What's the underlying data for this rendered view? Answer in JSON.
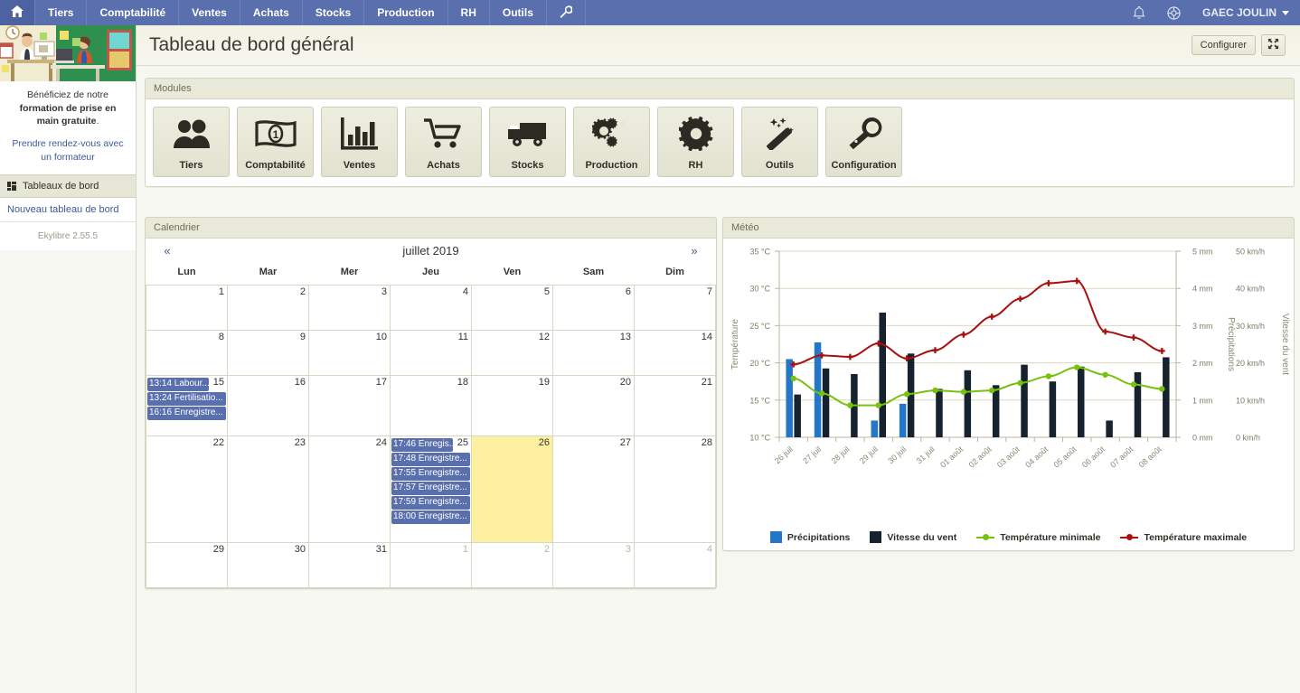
{
  "topnav": {
    "home_icon": "home-icon",
    "items": [
      {
        "label": "Tiers"
      },
      {
        "label": "Comptabilité"
      },
      {
        "label": "Ventes"
      },
      {
        "label": "Achats"
      },
      {
        "label": "Stocks"
      },
      {
        "label": "Production"
      },
      {
        "label": "RH"
      },
      {
        "label": "Outils"
      }
    ],
    "wrench_icon": "wrench-icon",
    "bell_icon": "bell-icon",
    "help_icon": "help-icon",
    "user": "GAEC JOULIN"
  },
  "sidebar": {
    "promo_text_plain_1": "Bénéficiez de notre ",
    "promo_text_bold": "formation de prise en main gratuite",
    "promo_text_plain_2": ".",
    "promo_link": "Prendre rendez-vous avec un formateur",
    "section_label": "Tableaux de bord",
    "new_dashboard_link": "Nouveau tableau de bord",
    "version": "Ekylibre 2.55.5"
  },
  "header": {
    "title": "Tableau de bord général",
    "configure_button": "Configurer",
    "fullscreen_icon": "fullscreen-icon"
  },
  "modules": {
    "panel_title": "Modules",
    "tiles": [
      {
        "label": "Tiers",
        "icon": "people-icon"
      },
      {
        "label": "Comptabilité",
        "icon": "banknote-icon"
      },
      {
        "label": "Ventes",
        "icon": "bar-chart-icon"
      },
      {
        "label": "Achats",
        "icon": "shopping-cart-icon"
      },
      {
        "label": "Stocks",
        "icon": "truck-icon"
      },
      {
        "label": "Production",
        "icon": "gears-icon"
      },
      {
        "label": "RH",
        "icon": "gear-icon"
      },
      {
        "label": "Outils",
        "icon": "magic-wand-icon"
      },
      {
        "label": "Configuration",
        "icon": "wrench-icon"
      }
    ]
  },
  "calendar": {
    "panel_title": "Calendrier",
    "prev_label": "«",
    "next_label": "»",
    "month_label": "juillet 2019",
    "weekdays": [
      "Lun",
      "Mar",
      "Mer",
      "Jeu",
      "Ven",
      "Sam",
      "Dim"
    ],
    "weeks": [
      [
        {
          "day": "1",
          "other": false,
          "today": false,
          "events": []
        },
        {
          "day": "2",
          "other": false,
          "today": false,
          "events": []
        },
        {
          "day": "3",
          "other": false,
          "today": false,
          "events": []
        },
        {
          "day": "4",
          "other": false,
          "today": false,
          "events": []
        },
        {
          "day": "5",
          "other": false,
          "today": false,
          "events": []
        },
        {
          "day": "6",
          "other": false,
          "today": false,
          "events": []
        },
        {
          "day": "7",
          "other": false,
          "today": false,
          "events": []
        }
      ],
      [
        {
          "day": "8",
          "other": false,
          "today": false,
          "events": []
        },
        {
          "day": "9",
          "other": false,
          "today": false,
          "events": []
        },
        {
          "day": "10",
          "other": false,
          "today": false,
          "events": []
        },
        {
          "day": "11",
          "other": false,
          "today": false,
          "events": []
        },
        {
          "day": "12",
          "other": false,
          "today": false,
          "events": []
        },
        {
          "day": "13",
          "other": false,
          "today": false,
          "events": []
        },
        {
          "day": "14",
          "other": false,
          "today": false,
          "events": []
        }
      ],
      [
        {
          "day": "15",
          "other": false,
          "today": false,
          "events": [
            "13:14 Labour...",
            "13:24 Fertilisatio...",
            "16:16 Enregistre..."
          ]
        },
        {
          "day": "16",
          "other": false,
          "today": false,
          "events": []
        },
        {
          "day": "17",
          "other": false,
          "today": false,
          "events": []
        },
        {
          "day": "18",
          "other": false,
          "today": false,
          "events": []
        },
        {
          "day": "19",
          "other": false,
          "today": false,
          "events": []
        },
        {
          "day": "20",
          "other": false,
          "today": false,
          "events": []
        },
        {
          "day": "21",
          "other": false,
          "today": false,
          "events": []
        }
      ],
      [
        {
          "day": "22",
          "other": false,
          "today": false,
          "events": []
        },
        {
          "day": "23",
          "other": false,
          "today": false,
          "events": []
        },
        {
          "day": "24",
          "other": false,
          "today": false,
          "events": []
        },
        {
          "day": "25",
          "other": false,
          "today": false,
          "events": [
            "17:46 Enregis...",
            "17:48 Enregistre...",
            "17:55 Enregistre...",
            "17:57 Enregistre...",
            "17:59 Enregistre...",
            "18:00 Enregistre..."
          ]
        },
        {
          "day": "26",
          "other": false,
          "today": true,
          "events": []
        },
        {
          "day": "27",
          "other": false,
          "today": false,
          "events": []
        },
        {
          "day": "28",
          "other": false,
          "today": false,
          "events": []
        }
      ],
      [
        {
          "day": "29",
          "other": false,
          "today": false,
          "events": []
        },
        {
          "day": "30",
          "other": false,
          "today": false,
          "events": []
        },
        {
          "day": "31",
          "other": false,
          "today": false,
          "events": []
        },
        {
          "day": "1",
          "other": true,
          "today": false,
          "events": []
        },
        {
          "day": "2",
          "other": true,
          "today": false,
          "events": []
        },
        {
          "day": "3",
          "other": true,
          "today": false,
          "events": []
        },
        {
          "day": "4",
          "other": true,
          "today": false,
          "events": []
        }
      ]
    ]
  },
  "weather": {
    "panel_title": "Météo"
  },
  "chart_data": {
    "type": "bar",
    "title": "Météo",
    "xlabel": "",
    "categories": [
      "26 juil",
      "27 juil",
      "28 juil",
      "29 juil",
      "30 juil",
      "31 juil",
      "01 août",
      "02 août",
      "03 août",
      "04 août",
      "05 août",
      "06 août",
      "07 août",
      "08 août"
    ],
    "axes": {
      "left": {
        "label": "Température",
        "ticks": [
          "10 °C",
          "15 °C",
          "20 °C",
          "25 °C",
          "30 °C",
          "35 °C"
        ],
        "min": 10,
        "max": 35,
        "unit": "°C"
      },
      "right1": {
        "label": "Précipitations",
        "ticks": [
          "0 mm",
          "1 mm",
          "2 mm",
          "3 mm",
          "4 mm",
          "5 mm"
        ],
        "min": 0,
        "max": 5,
        "unit": "mm"
      },
      "right2": {
        "label": "Vitesse du vent",
        "ticks": [
          "0 km/h",
          "10 km/h",
          "20 km/h",
          "30 km/h",
          "40 km/h",
          "50 km/h"
        ],
        "min": 0,
        "max": 50,
        "unit": "km/h"
      }
    },
    "grid": true,
    "legend_position": "bottom",
    "series": [
      {
        "name": "Précipitations",
        "type": "bar",
        "color": "#2477c8",
        "axis": "right1",
        "unit": "mm",
        "values": [
          2.1,
          2.55,
          0,
          0.45,
          0.9,
          0,
          0,
          0,
          0,
          0,
          0,
          0,
          0,
          0
        ]
      },
      {
        "name": "Vitesse du vent",
        "type": "bar",
        "color": "#16232e",
        "axis": "right2",
        "unit": "km/h",
        "values": [
          11.5,
          18.5,
          17.0,
          33.5,
          22.5,
          13.0,
          18.0,
          14.0,
          19.5,
          15.0,
          19.0,
          4.5,
          17.5,
          21.5
        ]
      },
      {
        "name": "Température minimale",
        "type": "line",
        "color": "#77c110",
        "axis": "left",
        "unit": "°C",
        "values": [
          17.9,
          15.9,
          14.3,
          14.3,
          15.8,
          16.3,
          16.1,
          16.3,
          17.3,
          18.2,
          19.4,
          18.4,
          17.1,
          16.5
        ]
      },
      {
        "name": "Température maximale",
        "type": "line",
        "color": "#a91010",
        "axis": "left",
        "unit": "°C",
        "values": [
          19.8,
          21.0,
          20.8,
          22.6,
          20.6,
          21.7,
          23.8,
          26.2,
          28.6,
          30.7,
          31.0,
          24.2,
          23.4,
          21.6
        ]
      }
    ]
  }
}
